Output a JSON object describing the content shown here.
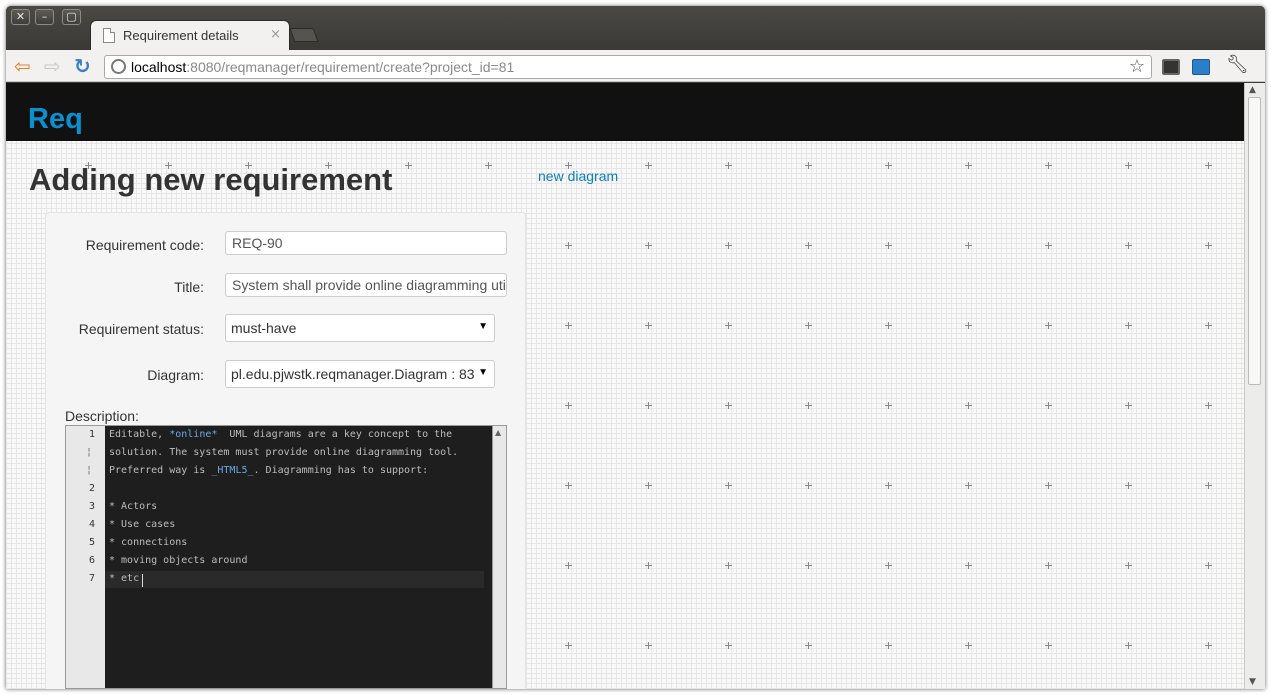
{
  "window": {
    "buttons": [
      "✕",
      "–",
      "▢"
    ]
  },
  "tab": {
    "title": "Requirement details",
    "close": "×"
  },
  "toolbar": {
    "url_host": "localhost",
    "url_rest": ":8080/reqmanager/requirement/create?project_id=81",
    "back_icon": "arrow-left",
    "forward_icon": "arrow-right",
    "reload_icon": "reload"
  },
  "navbar": {
    "brand": "Req"
  },
  "page": {
    "title": "Adding new requirement",
    "new_diagram_link": "new diagram"
  },
  "form": {
    "requirement_code": {
      "label": "Requirement code:",
      "value": "REQ-90"
    },
    "title": {
      "label": "Title:",
      "value": "System shall provide online diagramming utility"
    },
    "status": {
      "label": "Requirement status:",
      "value": "must-have"
    },
    "diagram": {
      "label": "Diagram:",
      "value": "pl.edu.pjwstk.reqmanager.Diagram : 83"
    },
    "description_label": "Description:"
  },
  "editor": {
    "line_numbers": [
      "1",
      "2",
      "3",
      "4",
      "5",
      "6",
      "7"
    ],
    "lines": {
      "l1a_pre": "Editable, ",
      "l1a_em": "*online*",
      "l1a_post": "  UML diagrams are a key concept to the",
      "l1b": "solution. The system must provide online diagramming tool.",
      "l1c_pre": "Preferred way is ",
      "l1c_em": "_HTML5_",
      "l1c_post": ". Diagramming has to support:",
      "l3": "* Actors",
      "l4": "* Use cases",
      "l5": "* connections",
      "l6": "* moving objects around",
      "l7": "* etc"
    }
  }
}
